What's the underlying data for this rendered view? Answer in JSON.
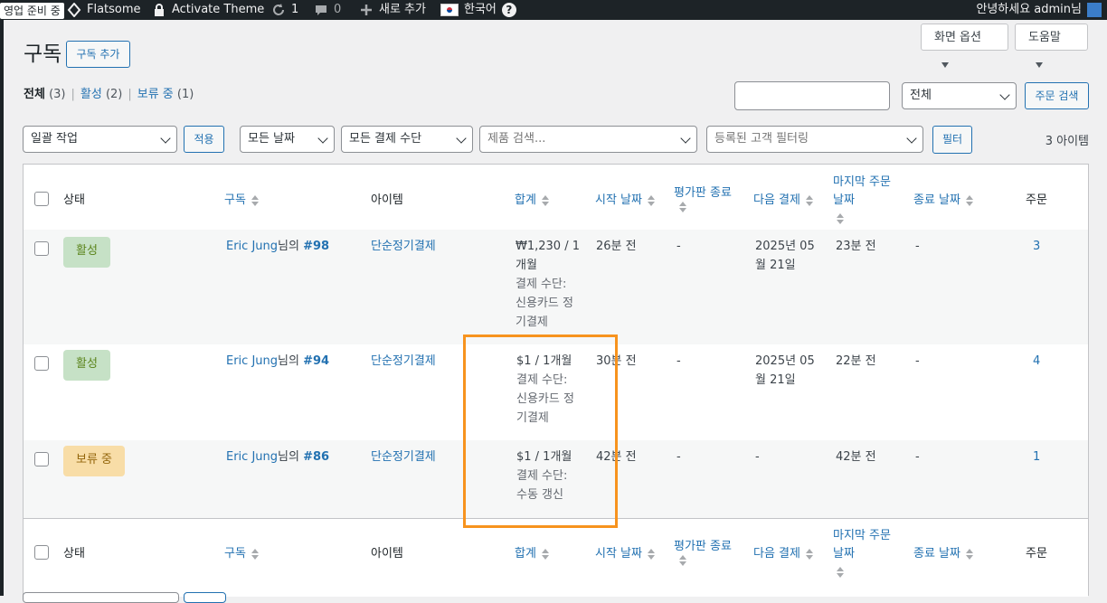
{
  "adminbar": {
    "coming_soon": "영업 준비 중",
    "site_name": "Flatsome",
    "activate_theme": "Activate Theme",
    "updates_count": "1",
    "comments_count": "0",
    "new_label": "새로 추가",
    "language": "한국어",
    "help": "?",
    "greeting": "안녕하세요 admin님"
  },
  "screen": {
    "screen_options": "화면 옵션",
    "help": "도움말"
  },
  "page": {
    "title": "구독",
    "add_button": "구독 추가"
  },
  "views": [
    {
      "label": "전체",
      "count": "(3)"
    },
    {
      "label": "활성",
      "count": "(2)"
    },
    {
      "label": "보류 중",
      "count": "(1)"
    }
  ],
  "search": {
    "input_value": "",
    "scope_value": "전체",
    "button": "주문 검색"
  },
  "filters": {
    "bulk_action": "일괄 작업",
    "apply": "적용",
    "all_dates": "모든 날짜",
    "all_payment_methods": "모든 결제 수단",
    "product_placeholder": "제품 검색...",
    "customer_placeholder": "등록된 고객 필터링",
    "filter_button": "필터",
    "items_count": "3 아이템"
  },
  "columns": {
    "status": "상태",
    "subscription": "구독",
    "items": "아이템",
    "total": "합계",
    "start_date": "시작 날짜",
    "trial_end_1": "평가판 종료",
    "next_payment": "다음 결제",
    "last_order_1": "마지막 주문",
    "last_order_2": "날짜",
    "end_date": "종료 날짜",
    "orders": "주문"
  },
  "rows": [
    {
      "status": "활성",
      "customer": "Eric Jung",
      "suffix": "님의",
      "sub_number": "#98",
      "item": "단순정기결제",
      "total_1": "₩1,230 / 1",
      "total_2": "개월",
      "pay_1": "결제 수단:",
      "pay_2": "신용카드 정",
      "pay_3": "기결제",
      "start": "26분 전",
      "trial": "-",
      "next_1": "2025년 05",
      "next_2": "월 21일",
      "last": "23분 전",
      "end": "-",
      "orders": "3"
    },
    {
      "status": "활성",
      "customer": "Eric Jung",
      "suffix": "님의",
      "sub_number": "#94",
      "item": "단순정기결제",
      "total_1": "$1 / 1개월",
      "pay_1": "결제 수단:",
      "pay_2": "신용카드 정",
      "pay_3": "기결제",
      "start": "30분 전",
      "trial": "-",
      "next_1": "2025년 05",
      "next_2": "월 21일",
      "last": "22분 전",
      "end": "-",
      "orders": "4"
    },
    {
      "status": "보류 중",
      "customer": "Eric Jung",
      "suffix": "님의",
      "sub_number": "#86",
      "item": "단순정기결제",
      "total_1": "$1 / 1개월",
      "pay_1": "결제 수단:",
      "pay_2": "수동 갱신",
      "start": "42분 전",
      "trial": "-",
      "next_1": "-",
      "last": "42분 전",
      "end": "-",
      "orders": "1"
    }
  ],
  "colors": {
    "highlight": "#f7931e",
    "link": "#2271b1",
    "active_bg": "#c6e1c6",
    "hold_bg": "#f8dda7"
  }
}
